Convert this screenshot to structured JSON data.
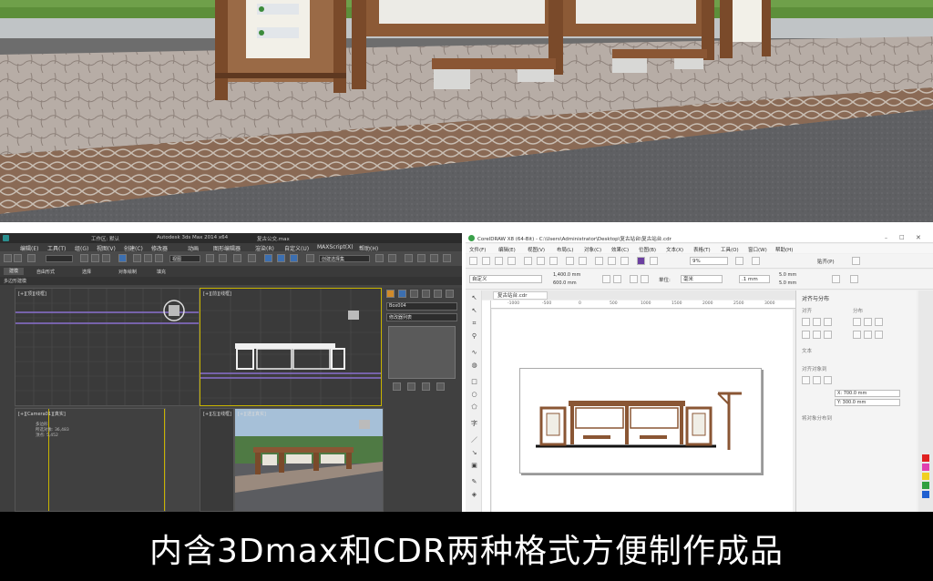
{
  "max": {
    "title": "Autodesk 3ds Max 2014 x64",
    "file_name": "复古公交.max",
    "workspace": "工作区: 默认",
    "menus": [
      "编辑(E)",
      "工具(T)",
      "组(G)",
      "视图(V)",
      "创建(C)",
      "修改器",
      "动画",
      "图形编辑器",
      "渲染(R)",
      "自定义(U)",
      "MAXScript(X)",
      "帮助(H)"
    ],
    "ribbon_tabs": [
      "建模",
      "自由形式",
      "选择",
      "对象绘制",
      "填充"
    ],
    "ribbon_sub": "多边形建模",
    "selection_set": "创建选择集",
    "view_filter": "视图",
    "viewports": {
      "top": "[+][顶][线框]",
      "front": "[+][前][线框]",
      "camera": "[+][Camera01][真实]",
      "left": "[+][左][线框]",
      "perspective": "[+][透][真实]"
    },
    "cam_stats": {
      "line1": "多边形",
      "line2": "所选对象: 36,483",
      "line3": "顶点: 5,452"
    },
    "object_name": "Box004",
    "modifier_list": "修改器列表"
  },
  "cdr": {
    "title": "CorelDRAW X8 (64-Bit) - C:\\Users\\Administrator\\Desktop\\复古站台\\复古站台.cdr",
    "menus": [
      "文件(F)",
      "编辑(E)",
      "视图(V)",
      "布局(L)",
      "对象(C)",
      "效果(C)",
      "位图(B)",
      "文本(X)",
      "表格(T)",
      "工具(O)",
      "窗口(W)",
      "帮助(H)"
    ],
    "zoom": "9%",
    "snap": "贴齐(P)",
    "page_preset": "自定义",
    "width": "1,400.0 mm",
    "height": "600.0 mm",
    "units_label": "单位:",
    "units": "毫米",
    "nudge": ".1 mm",
    "dup_x": "5.0 mm",
    "dup_y": "5.0 mm",
    "doc_tab": "复古站台.cdr",
    "panel_title": "对齐与分布",
    "panel_align": "对齐",
    "panel_distribute": "分布",
    "panel_text": "文本",
    "panel_obj": "对齐对象到",
    "panel_x": "X: 700.0 mm",
    "panel_y": "Y: 300.0 mm",
    "panel_dist_to": "将对象分布到",
    "ruler_ticks": [
      "-1000",
      "-500",
      "0",
      "500",
      "1000",
      "1500",
      "2000",
      "2500",
      "3000"
    ]
  },
  "banner": {
    "caption": "内含3Dmax和CDR两种格式方便制作成品"
  },
  "colors": {
    "wood": "#7a4a2a",
    "banner_bg": "#000000",
    "max_bg": "#444444",
    "cdr_bg": "#f0f0f0"
  }
}
